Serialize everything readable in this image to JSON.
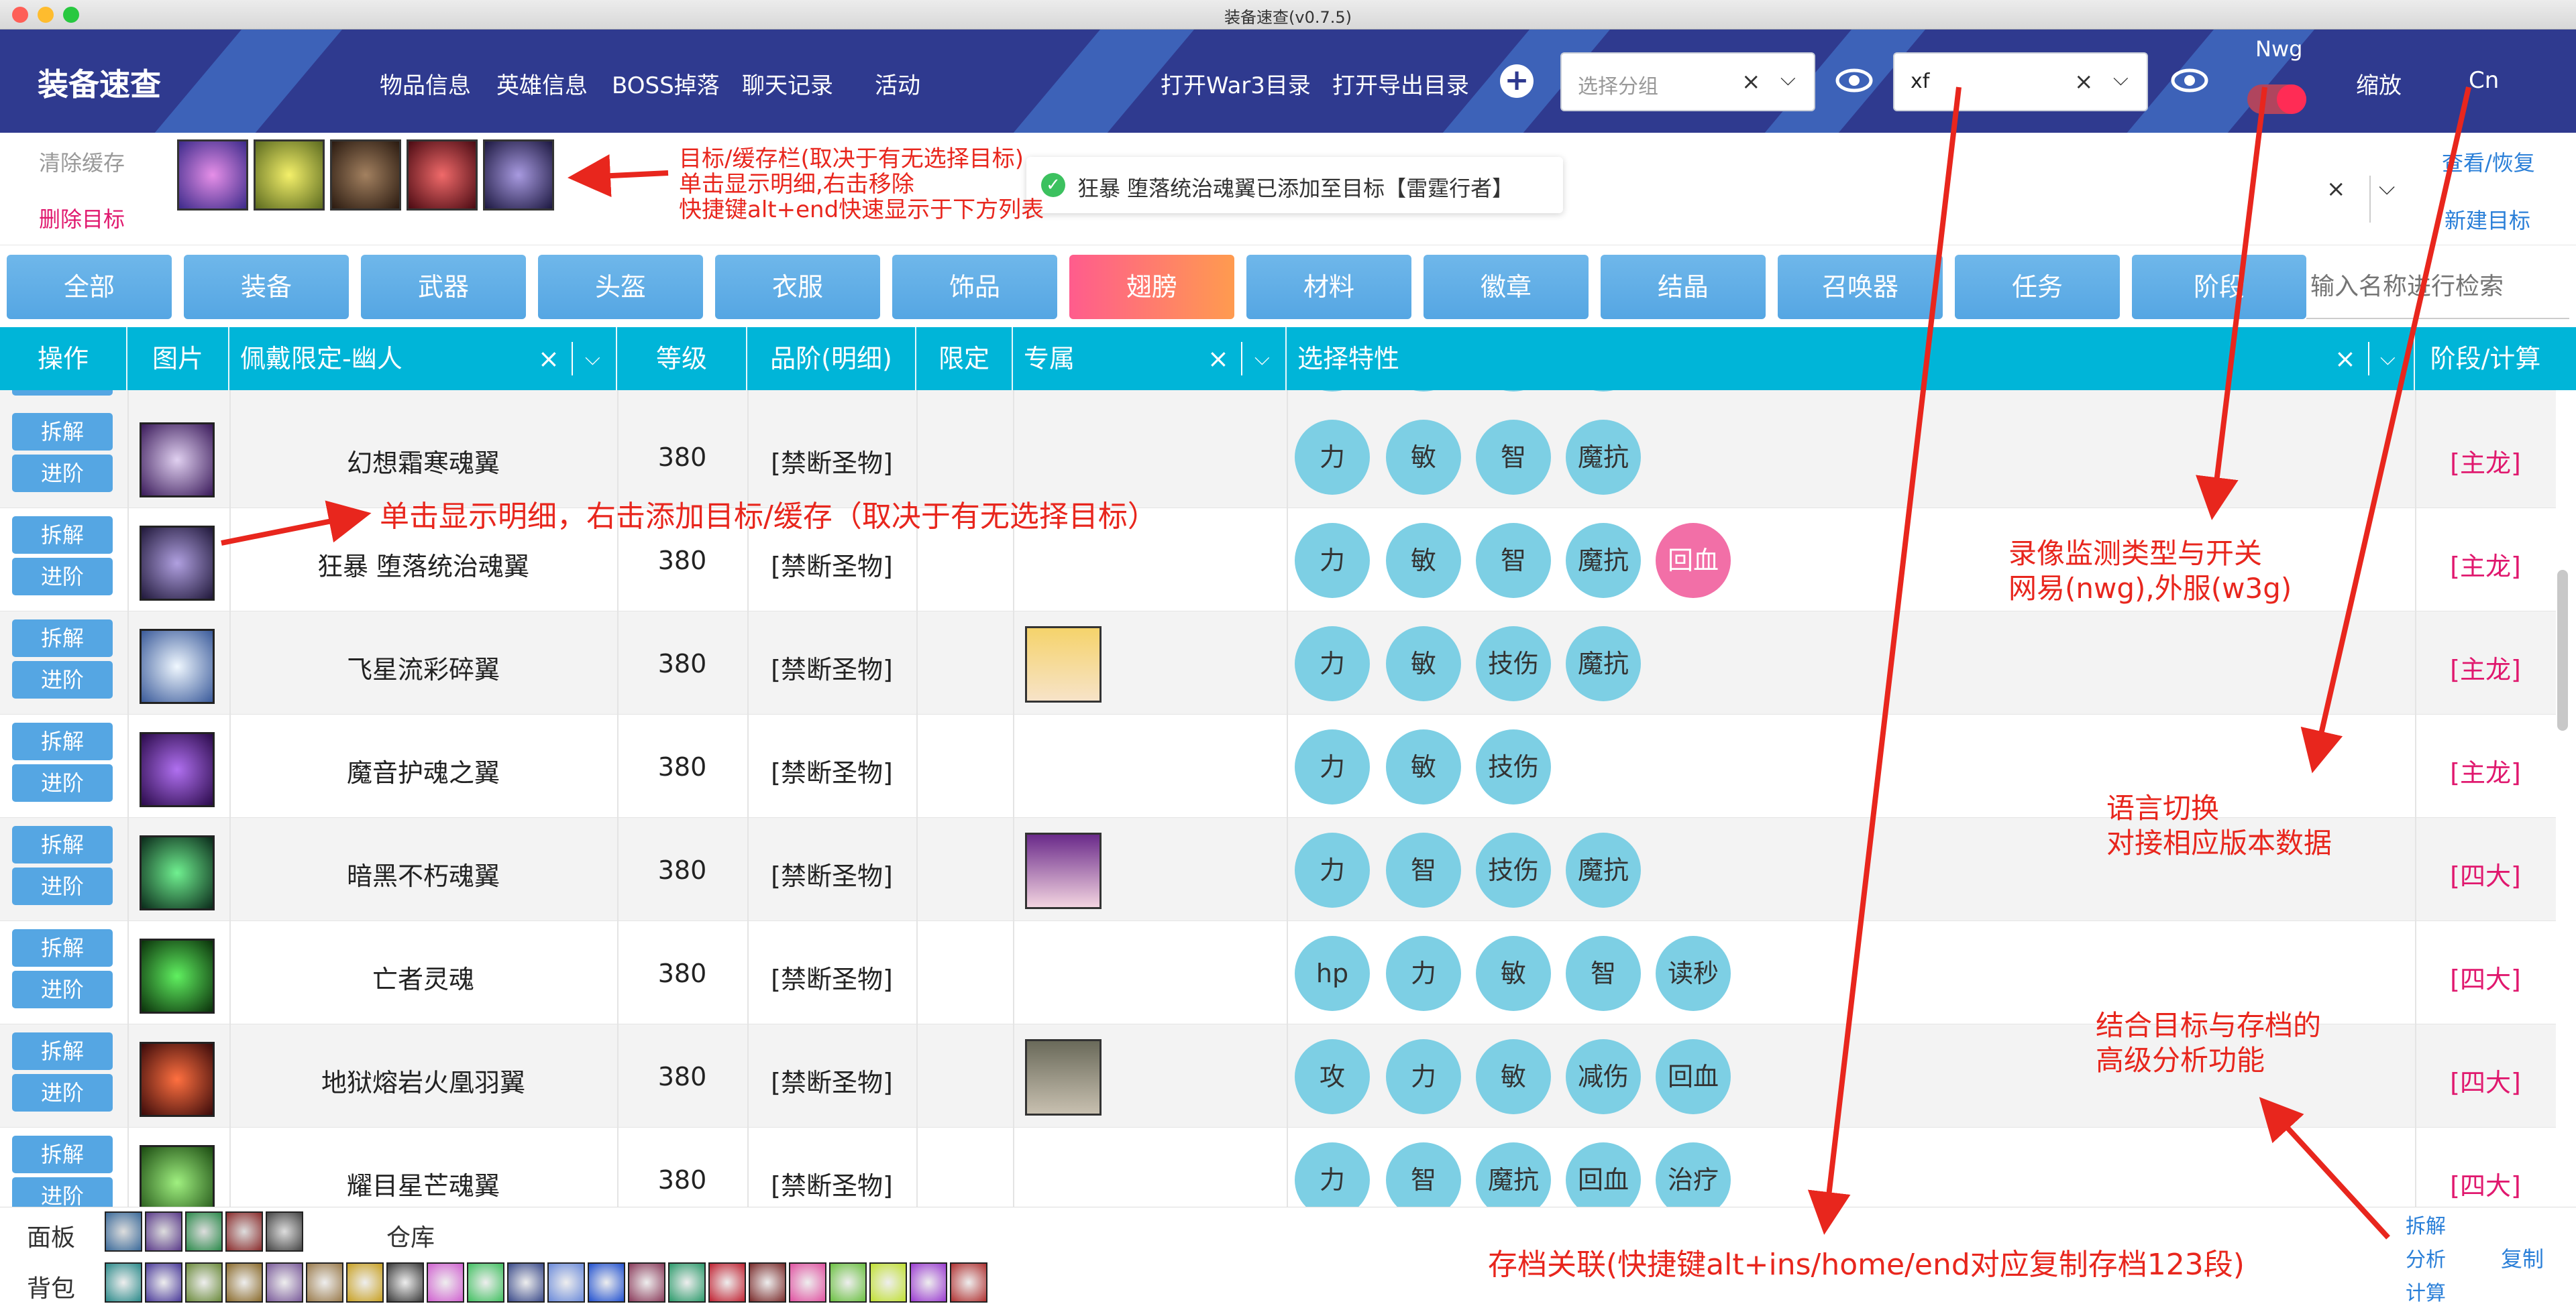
{
  "window": {
    "title": "装备速查(v0.7.5)"
  },
  "header": {
    "app_title": "装备速查",
    "nav": [
      "物品信息",
      "英雄信息",
      "BOSS掉落",
      "聊天记录",
      "活动"
    ],
    "open_war3": "打开War3目录",
    "open_export": "打开导出目录",
    "group_placeholder": "选择分组",
    "save_value": "xf",
    "mode_label": "Nwg",
    "zoom": "缩放",
    "lang": "Cn"
  },
  "target_bar": {
    "clear_cache": "清除缓存",
    "delete_target": "删除目标",
    "toast": "狂暴 堕落统治魂翼已添加至目标【雷霆行者】",
    "view_restore": "查看/恢复",
    "new_target": "新建目标"
  },
  "categories": [
    "全部",
    "装备",
    "武器",
    "头盔",
    "衣服",
    "饰品",
    "翅膀",
    "材料",
    "徽章",
    "结晶",
    "召唤器",
    "任务",
    "阶段"
  ],
  "active_category": "翅膀",
  "search_placeholder": "输入名称进行检索",
  "table": {
    "headers": {
      "op": "操作",
      "img": "图片",
      "wear": "佩戴限定-幽人",
      "level": "等级",
      "quality": "品阶(明细)",
      "limit": "限定",
      "exclusive": "专属",
      "traits": "选择特性",
      "stage": "阶段/计算"
    },
    "btn_split": "拆解",
    "btn_advance": "进阶",
    "rows": [
      {
        "name": "幻想霜寒魂翼",
        "level": "380",
        "quality": "[禁断圣物]",
        "traits": [
          "力",
          "敏",
          "智",
          "魔抗"
        ],
        "stage": "[主龙]",
        "icon": "skull-icon",
        "exclusive": false
      },
      {
        "name": "狂暴 堕落统治魂翼",
        "level": "380",
        "quality": "[禁断圣物]",
        "traits": [
          "力",
          "敏",
          "智",
          "魔抗",
          "回血"
        ],
        "stage": "[主龙]",
        "icon": "dark-wing-icon",
        "exclusive": false
      },
      {
        "name": "飞星流彩碎翼",
        "level": "380",
        "quality": "[禁断圣物]",
        "traits": [
          "力",
          "敏",
          "技伤",
          "魔抗"
        ],
        "stage": "[主龙]",
        "icon": "crystal-wing-icon",
        "exclusive": true
      },
      {
        "name": "魔音护魂之翼",
        "level": "380",
        "quality": "[禁断圣物]",
        "traits": [
          "力",
          "敏",
          "技伤"
        ],
        "stage": "[主龙]",
        "icon": "purple-cape-icon",
        "exclusive": false
      },
      {
        "name": "暗黑不朽魂翼",
        "level": "380",
        "quality": "[禁断圣物]",
        "traits": [
          "力",
          "智",
          "技伤",
          "魔抗"
        ],
        "stage": "[四大]",
        "icon": "green-skull-icon",
        "exclusive": true
      },
      {
        "name": "亡者灵魂",
        "level": "380",
        "quality": "[禁断圣物]",
        "traits": [
          "hp",
          "力",
          "敏",
          "智",
          "读秒"
        ],
        "stage": "[四大]",
        "icon": "green-spirit-icon",
        "exclusive": false
      },
      {
        "name": "地狱熔岩火凰羽翼",
        "level": "380",
        "quality": "[禁断圣物]",
        "traits": [
          "攻",
          "力",
          "敏",
          "减伤",
          "回血"
        ],
        "stage": "[四大]",
        "icon": "fire-wing-icon",
        "exclusive": true
      },
      {
        "name": "耀目星芒魂翼",
        "level": "380",
        "quality": "[禁断圣物]",
        "traits": [
          "力",
          "智",
          "魔抗",
          "回血",
          "治疗"
        ],
        "stage": "[四大]",
        "icon": "green-feather-icon",
        "exclusive": false
      }
    ]
  },
  "bottom": {
    "panel": "面板",
    "warehouse": "仓库",
    "bag": "背包",
    "split_analysis": [
      "拆解",
      "分析",
      "计算"
    ],
    "copy": "复制"
  },
  "annotations": {
    "target_bar": [
      "目标/缓存栏(取决于有无选择目标)",
      "单击显示明细,右击移除",
      "快捷键alt+end快速显示于下方列表"
    ],
    "click_detail": "单击显示明细，右击添加目标/缓存（取决于有无选择目标）",
    "recording": [
      "录像监测类型与开关",
      "网易(nwg),外服(w3g)"
    ],
    "language": [
      "语言切换",
      "对接相应版本数据"
    ],
    "analysis": [
      "结合目标与存档的",
      "高级分析功能"
    ],
    "archive": "存档关联(快捷键alt+ins/home/end对应复制存档123段)"
  },
  "colors": {
    "header_bg": "#2f3a8f",
    "table_header": "#00b5d8",
    "chip": "#7dcfe4",
    "chip_pink": "#f26fa7",
    "stage": "#e0186e",
    "annotation": "#e8261d"
  }
}
